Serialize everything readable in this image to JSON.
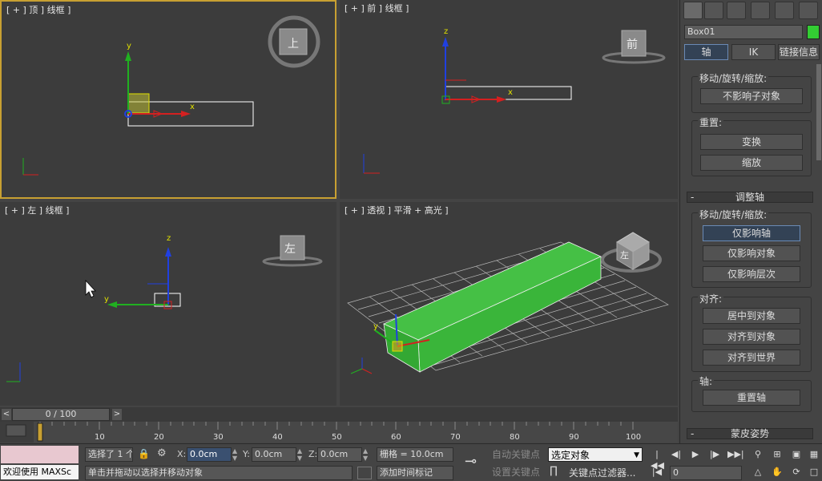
{
  "viewports": {
    "top": {
      "label": "[ + ] 顶 ] 线框 ]",
      "nav": "上"
    },
    "front": {
      "label": "[ + ] 前 ] 线框 ]",
      "nav": "前"
    },
    "left": {
      "label": "[ + ] 左 ] 线框 ]",
      "nav": "左"
    },
    "persp": {
      "label": "[ + ] 透视 ] 平滑 + 高光 ]",
      "nav": "左"
    },
    "axis_x": "x",
    "axis_y": "y",
    "axis_z": "z"
  },
  "command_panel": {
    "object_name": "Box01",
    "object_color": "#33cc33",
    "tabs": [
      "轴",
      "IK",
      "链接信息"
    ],
    "groups": {
      "move_rotate_scale_1": "移动/旋转/缩放:",
      "no_affect_children": "不影响子对象",
      "reset": "重置:",
      "transform": "变换",
      "scale": "缩放"
    },
    "adjust_pivot": {
      "rollout": "调整轴",
      "move_rotate_scale": "移动/旋转/缩放:",
      "affect_pivot_only": "仅影响轴",
      "affect_object_only": "仅影响对象",
      "affect_hierarchy_only": "仅影响层次",
      "align": "对齐:",
      "center_to_object": "居中到对象",
      "align_to_object": "对齐到对象",
      "align_to_world": "对齐到世界",
      "pivot": "轴:",
      "reset_pivot": "重置轴"
    },
    "skin_pose_rollout": "蒙皮姿势",
    "rollout_sign": "-"
  },
  "timeline": {
    "slider_text": "0 / 100",
    "ticks": [
      "10",
      "20",
      "30",
      "40",
      "50",
      "60",
      "70",
      "80",
      "90",
      "100"
    ],
    "left_arrow": "<",
    "right_arrow": ">"
  },
  "status": {
    "welcome": "欢迎使用 MAXSc",
    "selected": "选择了 1 个",
    "prompt": "单击并拖动以选择并移动对象",
    "x_label": "X:",
    "x_value": "0.0cm",
    "y_label": "Y:",
    "y_value": "0.0cm",
    "z_label": "Z:",
    "z_value": "0.0cm",
    "grid": "栅格 = 10.0cm",
    "add_time_tag": "添加时间标记",
    "auto_key": "自动关键点",
    "set_key": "设置关键点",
    "key_mode": "选定对象",
    "key_filters": "关键点过滤器...",
    "frame": "0"
  },
  "colors": {
    "viewport_bg": "#3c3c3c",
    "active_border": "#c8a032",
    "box_green": "#3ab53a",
    "axis_x": "#d42020",
    "axis_y": "#20b020",
    "axis_z": "#2040e0"
  }
}
